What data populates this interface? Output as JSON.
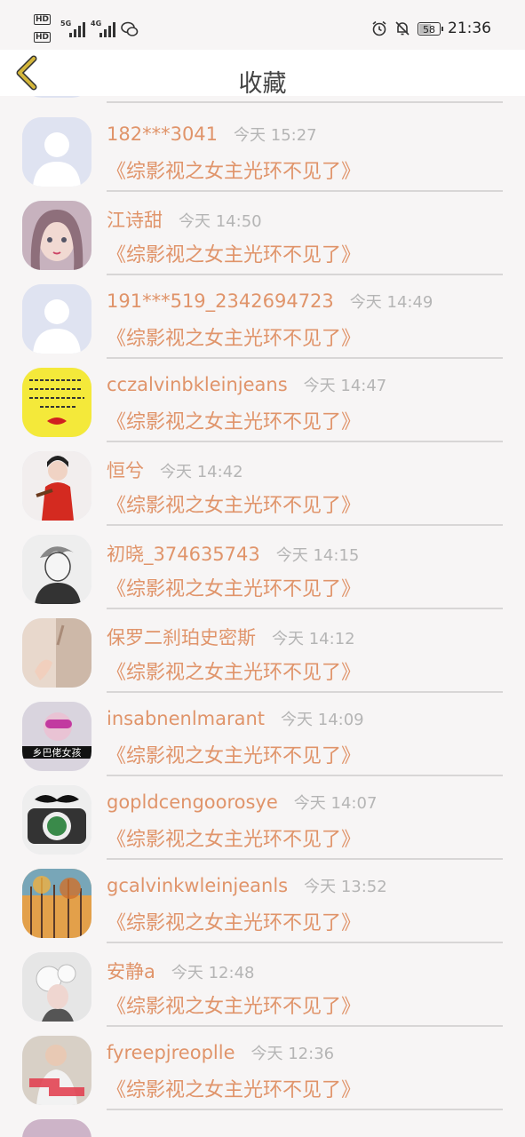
{
  "status_bar": {
    "hd1": "HD",
    "hd2": "HD",
    "net1": "5G",
    "net2": "4G",
    "battery": "58",
    "time": "21:36"
  },
  "header": {
    "title": "收藏"
  },
  "items": [
    {
      "name": "182***3041",
      "time": "今天 15:27",
      "book": "《综影视之女主光环不见了》"
    },
    {
      "name": "江诗甜",
      "time": "今天 14:50",
      "book": "《综影视之女主光环不见了》"
    },
    {
      "name": "191***519_2342694723",
      "time": "今天 14:49",
      "book": "《综影视之女主光环不见了》"
    },
    {
      "name": "cczalvinbkleinjeans",
      "time": "今天 14:47",
      "book": "《综影视之女主光环不见了》"
    },
    {
      "name": "恒兮",
      "time": "今天 14:42",
      "book": "《综影视之女主光环不见了》"
    },
    {
      "name": "初晓_374635743",
      "time": "今天 14:15",
      "book": "《综影视之女主光环不见了》"
    },
    {
      "name": "保罗二刹珀史密斯",
      "time": "今天 14:12",
      "book": "《综影视之女主光环不见了》"
    },
    {
      "name": "insabnenlmarant",
      "time": "今天 14:09",
      "book": "《综影视之女主光环不见了》"
    },
    {
      "name": "gopldcengoorosye",
      "time": "今天 14:07",
      "book": "《综影视之女主光环不见了》"
    },
    {
      "name": "gcalvinkwleinjeanls",
      "time": "今天 13:52",
      "book": "《综影视之女主光环不见了》"
    },
    {
      "name": "安静a",
      "time": "今天 12:48",
      "book": "《综影视之女主光环不见了》"
    },
    {
      "name": "fyreepjreoplle",
      "time": "今天 12:36",
      "book": "《综影视之女主光环不见了》"
    }
  ],
  "avatar_badges": {
    "item7": "乡巴佬女孩"
  },
  "colors": {
    "accent": "#e0946a",
    "back_arrow": "#d4b63a",
    "time": "#b5b5b5"
  }
}
